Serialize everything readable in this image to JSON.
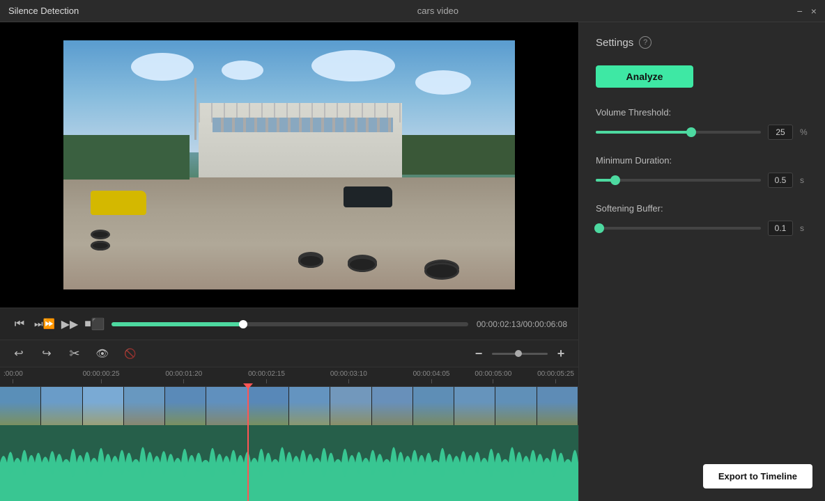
{
  "app": {
    "title": "Silence Detection",
    "window_title": "cars video",
    "minimize_label": "−",
    "close_label": "×"
  },
  "settings_panel": {
    "settings_label": "Settings",
    "analyze_label": "Analyze",
    "volume_threshold": {
      "label": "Volume Threshold:",
      "value": "25",
      "unit": "%",
      "fill_pct": 58
    },
    "minimum_duration": {
      "label": "Minimum Duration:",
      "value": "0.5",
      "unit": "s",
      "fill_pct": 12
    },
    "softening_buffer": {
      "label": "Softening Buffer:",
      "value": "0.1",
      "unit": "s",
      "fill_pct": 2
    }
  },
  "playback": {
    "current_time": "00:00:02:13",
    "total_time": "00:00:06:08",
    "time_display": "00:00:02:13/00:00:06:08",
    "progress_pct": 37
  },
  "timeline": {
    "ruler_marks": [
      {
        "label": ":00:00",
        "pct": 0
      },
      {
        "label": "00:00:00:25",
        "pct": 14.3
      },
      {
        "label": "00:00:01:20",
        "pct": 28.6
      },
      {
        "label": "00:00:02:15",
        "pct": 42.9
      },
      {
        "label": "00:00:03:10",
        "pct": 57.1
      },
      {
        "label": "00:00:04:05",
        "pct": 71.4
      },
      {
        "label": "00:00:05:00",
        "pct": 82.1
      },
      {
        "label": "00:00:05:25",
        "pct": 92.9
      }
    ],
    "playhead_pct": 42.9
  },
  "export_button": {
    "label": "Export to Timeline"
  },
  "toolbar": {
    "undo_label": "Undo",
    "redo_label": "Redo",
    "scissors_label": "Cut",
    "eye_label": "Show/Hide",
    "eye_off_label": "Mute"
  }
}
